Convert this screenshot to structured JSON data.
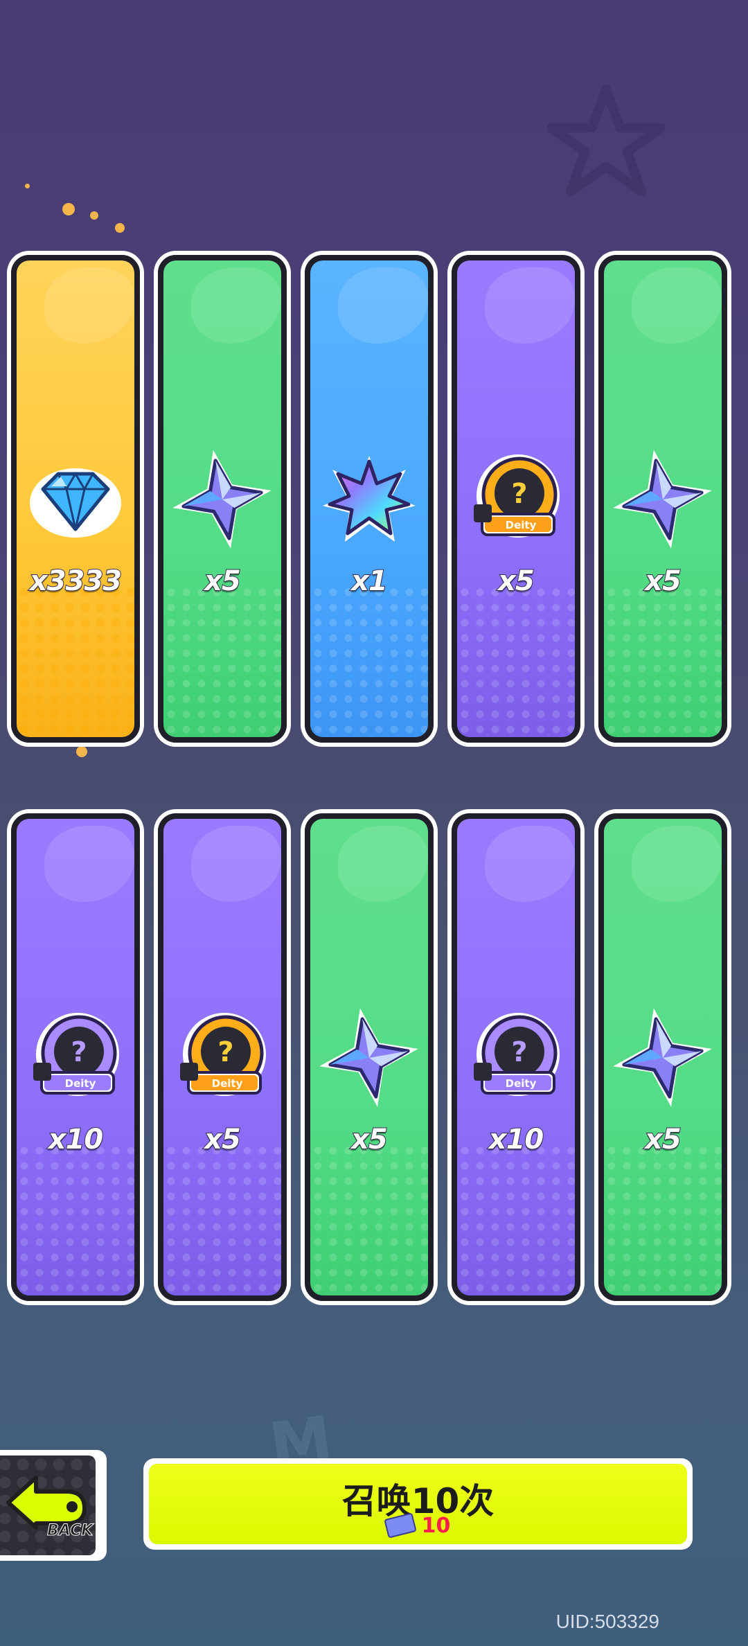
{
  "rewards": [
    {
      "item": "diamond-icon",
      "qty": "x3333",
      "rarity": "yellow"
    },
    {
      "item": "star-shard-icon",
      "qty": "x5",
      "rarity": "green"
    },
    {
      "item": "rainbow-leaf-icon",
      "qty": "x1",
      "rarity": "blue"
    },
    {
      "item": "deity-gold-icon",
      "qty": "x5",
      "rarity": "purple"
    },
    {
      "item": "star-shard-icon",
      "qty": "x5",
      "rarity": "green"
    },
    {
      "item": "deity-purple-icon",
      "qty": "x10",
      "rarity": "purple"
    },
    {
      "item": "deity-gold-icon",
      "qty": "x5",
      "rarity": "purple"
    },
    {
      "item": "star-shard-icon",
      "qty": "x5",
      "rarity": "green"
    },
    {
      "item": "deity-purple-icon",
      "qty": "x10",
      "rarity": "purple"
    },
    {
      "item": "star-shard-icon",
      "qty": "x5",
      "rarity": "green"
    }
  ],
  "back_button": {
    "label": "BACK"
  },
  "summon_button": {
    "title": "召唤10次",
    "cost": "10",
    "cost_icon": "ticket-icon"
  },
  "uid": "UID:503329",
  "deity_label": "Deity",
  "colors": {
    "yellow": "#ffc93b",
    "green": "#54dc86",
    "blue": "#4aa8ff",
    "purple": "#8e6ffb",
    "summon_button": "#e8ff05",
    "cost_text": "#ff1e4c"
  }
}
